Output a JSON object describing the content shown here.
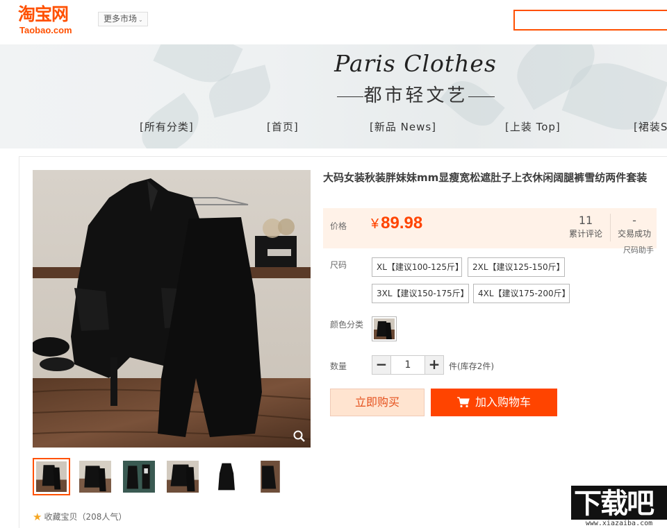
{
  "header": {
    "logo_cn": "淘宝网",
    "logo_en": "Taobao.com",
    "more_market": "更多市场",
    "search_placeholder": "",
    "accent_color": "#ff5000"
  },
  "banner": {
    "title": "Paris Clothes",
    "subtitle": "都市轻文艺",
    "nav": [
      "[所有分类]",
      "[首页]",
      "[新品 News]",
      "[上装 Top]",
      "[裙装S"
    ]
  },
  "product": {
    "title": "大码女装秋装胖妹妹mm显瘦宽松遮肚子上衣休闲阔腿裤雪纺两件套装",
    "price_label": "价格",
    "currency": "¥",
    "price": "89.98",
    "reviews_count": "11",
    "reviews_label": "累计评论",
    "deals_count": "-",
    "deals_label": "交易成功",
    "size_helper": "尺码助手",
    "size_label": "尺码",
    "sizes": [
      "XL【建议100-125斤】",
      "2XL【建议125-150斤】",
      "3XL【建议150-175斤】",
      "4XL【建议175-200斤】"
    ],
    "color_label": "颜色分类",
    "quantity_label": "数量",
    "quantity_value": "1",
    "quantity_minus": "−",
    "quantity_plus": "+",
    "stock_text": "件(库存2件)",
    "buy_now": "立即购买",
    "add_to_cart": "加入购物车",
    "favorite": "收藏宝贝（208人气）",
    "favorite_star": "★",
    "zoom_icon": "magnifier-icon",
    "price_color": "#ff4400"
  },
  "watermark": {
    "text": "下载吧",
    "url": "www.xiazaiba.com"
  }
}
